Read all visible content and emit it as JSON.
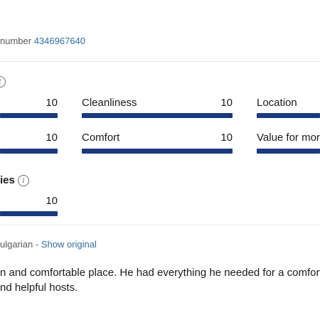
{
  "property_number": {
    "label": "number",
    "value": "4346967640"
  },
  "scores": [
    {
      "label": "",
      "value": "10",
      "fill": 1.0
    },
    {
      "label": "Cleanliness",
      "value": "10",
      "fill": 1.0
    },
    {
      "label": "Location",
      "value": "",
      "fill": 1.0
    },
    {
      "label": "",
      "value": "10",
      "fill": 1.0
    },
    {
      "label": "Comfort",
      "value": "10",
      "fill": 1.0
    },
    {
      "label": "Value for mor",
      "value": "",
      "fill": 1.0
    }
  ],
  "facilities": {
    "heading": "ies",
    "value": "10",
    "fill": 1.0
  },
  "translation": {
    "language_text": "ulgarian",
    "separator": " - ",
    "show_original": "Show original"
  },
  "review": {
    "line1": "n and comfortable place. He had everything he needed for a comfort",
    "line2": "nd helpful hosts."
  },
  "colors": {
    "bar_fill": "#1a3a7e",
    "link": "#2f6da3"
  },
  "icons": [
    "info-icon"
  ]
}
